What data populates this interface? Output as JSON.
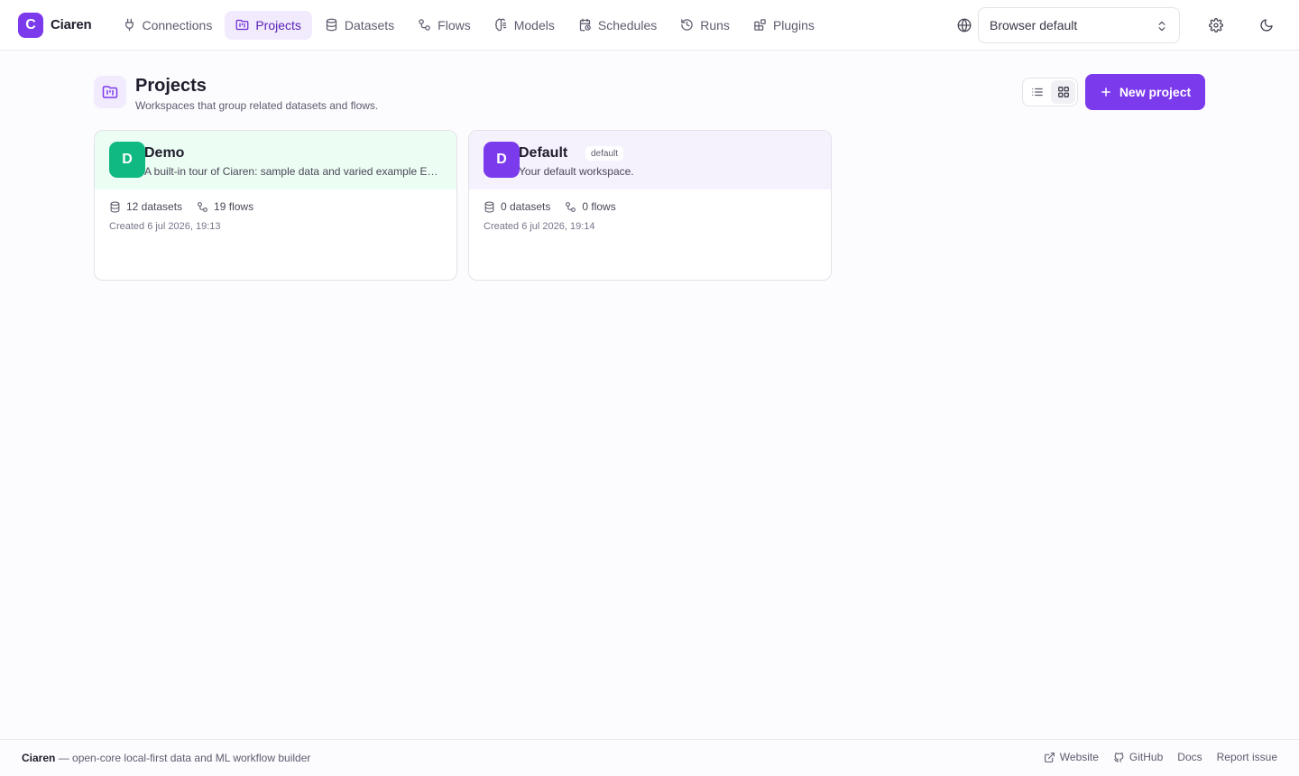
{
  "brand": {
    "logo_letter": "C",
    "name": "Ciaren"
  },
  "nav": {
    "items": [
      {
        "label": "Connections",
        "icon": "plug-icon"
      },
      {
        "label": "Projects",
        "icon": "folder-kanban-icon",
        "active": true
      },
      {
        "label": "Datasets",
        "icon": "database-icon"
      },
      {
        "label": "Flows",
        "icon": "workflow-icon"
      },
      {
        "label": "Models",
        "icon": "brain-icon"
      },
      {
        "label": "Schedules",
        "icon": "calendar-clock-icon"
      },
      {
        "label": "Runs",
        "icon": "history-icon"
      },
      {
        "label": "Plugins",
        "icon": "blocks-icon"
      }
    ]
  },
  "locale": {
    "value": "Browser default"
  },
  "header": {
    "title": "Projects",
    "subtitle": "Workspaces that group related datasets and flows.",
    "new_button": "New project"
  },
  "view": {
    "mode": "grid"
  },
  "projects": [
    {
      "avatar": "D",
      "name": "Demo",
      "description": "A built-in tour of Ciaren: sample data and varied example ETL flows",
      "datasets": "12 datasets",
      "flows": "19 flows",
      "created": "Created 6 jul 2026, 19:13",
      "avatar_color": "#10b981",
      "head_color": "#ecfdf3"
    },
    {
      "avatar": "D",
      "name": "Default",
      "badge": "default",
      "description": "Your default workspace.",
      "datasets": "0 datasets",
      "flows": "0 flows",
      "created": "Created 6 jul 2026, 19:14",
      "avatar_color": "#7c3aed",
      "head_color": "#f6f2fd"
    }
  ],
  "footer": {
    "brand": "Ciaren",
    "tagline": " — open-core local-first data and ML workflow builder",
    "links": {
      "website": "Website",
      "github": "GitHub",
      "docs": "Docs",
      "report": "Report issue"
    }
  },
  "colors": {
    "accent": "#7c3aed",
    "accent_soft": "#f1ebfd"
  }
}
